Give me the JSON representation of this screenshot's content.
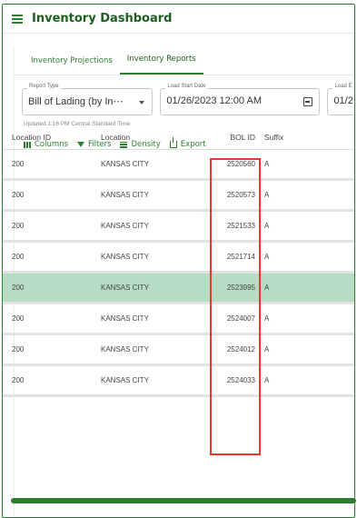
{
  "app": {
    "title": "Inventory Dashboard"
  },
  "tabs": [
    {
      "label": "Inventory Projections"
    },
    {
      "label": "Inventory Reports"
    }
  ],
  "filters": {
    "report_type": {
      "label": "Report Type",
      "value": "Bill of Lading (by In⋯"
    },
    "load_start_date": {
      "label": "Load Start Date",
      "value": "01/26/2023 12:00 AM"
    },
    "load_end_date": {
      "label": "Load E",
      "value": "01/2"
    }
  },
  "updated_text": "Updated 1:16 PM Central Standard Time",
  "toolbar": {
    "columns": "Columns",
    "filters": "Filters",
    "density": "Density",
    "export": "Export"
  },
  "grid": {
    "headers": [
      "Location ID",
      "Location",
      "BOL ID",
      "Suffix"
    ],
    "rows": [
      [
        "200",
        "KANSAS CITY",
        "2520560",
        "A"
      ],
      [
        "200",
        "KANSAS CITY",
        "2520573",
        "A"
      ],
      [
        "200",
        "KANSAS CITY",
        "2521533",
        "A"
      ],
      [
        "200",
        "KANSAS CITY",
        "2521714",
        "A"
      ],
      [
        "200",
        "KANSAS CITY",
        "2523995",
        "A"
      ],
      [
        "200",
        "KANSAS CITY",
        "2524007",
        "A"
      ],
      [
        "200",
        "KANSAS CITY",
        "2524012",
        "A"
      ],
      [
        "200",
        "KANSAS CITY",
        "2524033",
        "A"
      ]
    ],
    "selected_row_index": 4
  },
  "colors": {
    "accent": "#2e7d32",
    "selected_row": "#b7dcc4",
    "highlight": "#e53935"
  }
}
